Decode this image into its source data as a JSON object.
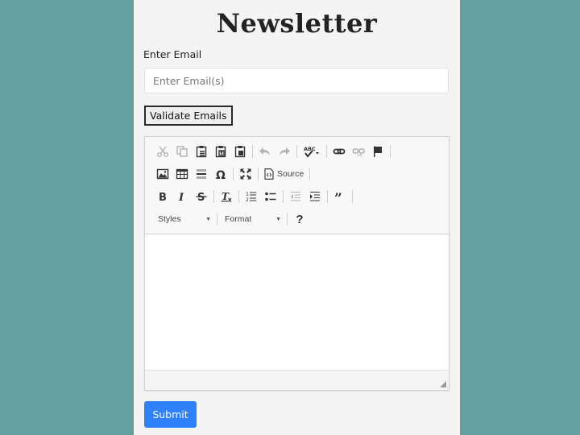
{
  "page": {
    "title": "Newsletter",
    "background_color": "#64a0a0",
    "panel_color": "#f4f4f4"
  },
  "form": {
    "email_label": "Enter Email",
    "email_value": "",
    "email_placeholder": "Enter Email(s)",
    "validate_label": "Validate Emails",
    "submit_label": "Submit",
    "submit_color": "#2f80fb"
  },
  "editor": {
    "content": "",
    "toolbar": {
      "row1": [
        {
          "icon": "cut-icon",
          "label": "Cut",
          "enabled": false
        },
        {
          "icon": "copy-icon",
          "label": "Copy",
          "enabled": false
        },
        {
          "icon": "paste-icon",
          "label": "Paste",
          "enabled": true
        },
        {
          "icon": "paste-text-icon",
          "label": "Paste as plain text",
          "enabled": true
        },
        {
          "icon": "paste-word-icon",
          "label": "Paste from Word",
          "enabled": true
        },
        {
          "icon": "undo-icon",
          "label": "Undo",
          "enabled": false
        },
        {
          "icon": "redo-icon",
          "label": "Redo",
          "enabled": false
        },
        {
          "icon": "spellcheck-icon",
          "label": "Spell Check As You Type",
          "enabled": true
        },
        {
          "icon": "link-icon",
          "label": "Link",
          "enabled": true
        },
        {
          "icon": "unlink-icon",
          "label": "Unlink",
          "enabled": false
        },
        {
          "icon": "anchor-flag-icon",
          "label": "Anchor",
          "enabled": true
        }
      ],
      "row2": [
        {
          "icon": "image-icon",
          "label": "Image",
          "enabled": true
        },
        {
          "icon": "table-icon",
          "label": "Table",
          "enabled": true
        },
        {
          "icon": "horizontal-line-icon",
          "label": "Insert Horizontal Line",
          "enabled": true
        },
        {
          "icon": "special-char-icon",
          "label": "Insert Special Character",
          "enabled": true
        },
        {
          "icon": "maximize-icon",
          "label": "Maximize",
          "enabled": true
        }
      ],
      "source_label": "Source",
      "row3": [
        {
          "icon": "bold-icon",
          "label": "Bold",
          "enabled": true
        },
        {
          "icon": "italic-icon",
          "label": "Italic",
          "enabled": true
        },
        {
          "icon": "strike-icon",
          "label": "Strikethrough",
          "enabled": true
        },
        {
          "icon": "remove-format-icon",
          "label": "Remove Format",
          "enabled": true
        },
        {
          "icon": "numbered-list-icon",
          "label": "Insert/Remove Numbered List",
          "enabled": true
        },
        {
          "icon": "bulleted-list-icon",
          "label": "Insert/Remove Bulleted List",
          "enabled": true
        },
        {
          "icon": "outdent-icon",
          "label": "Decrease Indent",
          "enabled": false
        },
        {
          "icon": "indent-icon",
          "label": "Increase Indent",
          "enabled": true
        },
        {
          "icon": "blockquote-icon",
          "label": "Block Quote",
          "enabled": true
        }
      ],
      "styles_label": "Styles",
      "format_label": "Format",
      "help_label": "?"
    }
  }
}
